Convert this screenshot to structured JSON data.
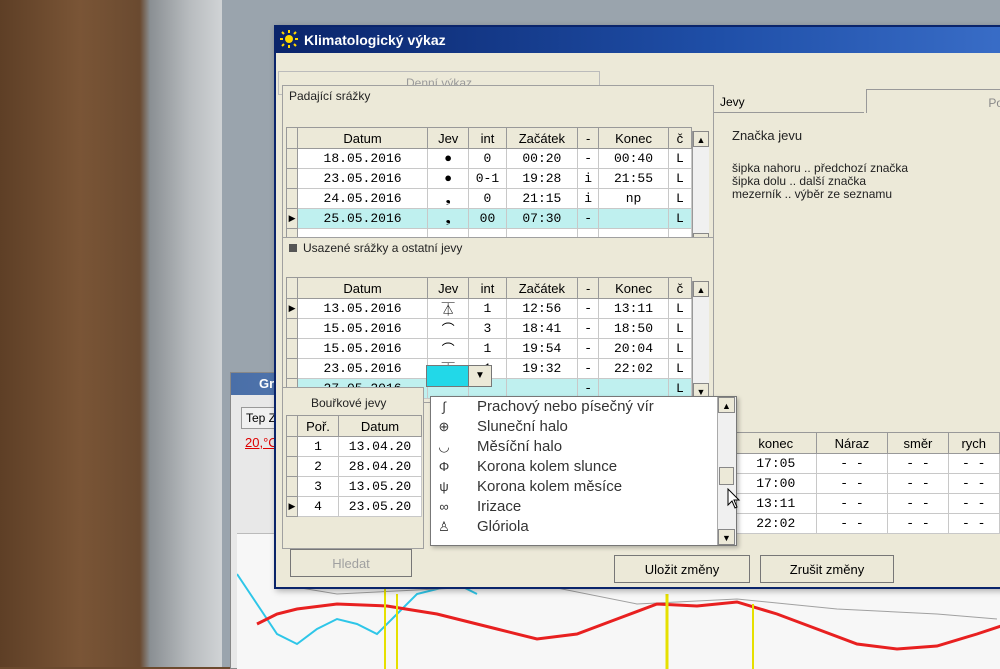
{
  "window": {
    "title": "Klimatologický výkaz",
    "daily_tab": "Denní výkaz"
  },
  "falling": {
    "caption": "Padající srážky",
    "columns": [
      "Datum",
      "Jev",
      "int",
      "Začátek",
      "-",
      "Konec",
      "č"
    ],
    "rows": [
      {
        "date": "18.05.2016",
        "jev": "●",
        "int": "0",
        "start": "00:20",
        "dash": "-",
        "end": "00:40",
        "c": "L"
      },
      {
        "date": "23.05.2016",
        "jev": "●",
        "int": "0-1",
        "start": "19:28",
        "dash": "i",
        "end": "21:55",
        "c": "L"
      },
      {
        "date": "24.05.2016",
        "jev": "❟",
        "int": "0",
        "start": "21:15",
        "dash": "i",
        "end": "np",
        "c": "L"
      },
      {
        "date": "25.05.2016",
        "jev": "❟",
        "int": "00",
        "start": "07:30",
        "dash": "-",
        "end": "",
        "c": "L"
      }
    ]
  },
  "settled": {
    "caption": "Usazené srážky a ostatní jevy",
    "columns": [
      "Datum",
      "Jev",
      "int",
      "Začátek",
      "-",
      "Konec",
      "č"
    ],
    "rows": [
      {
        "date": "13.05.2016",
        "jev": "⏄",
        "int": "1",
        "start": "12:56",
        "dash": "-",
        "end": "13:11",
        "c": "L"
      },
      {
        "date": "15.05.2016",
        "jev": "⌒",
        "int": "3",
        "start": "18:41",
        "dash": "-",
        "end": "18:50",
        "c": "L"
      },
      {
        "date": "15.05.2016",
        "jev": "⌒",
        "int": "1",
        "start": "19:54",
        "dash": "-",
        "end": "20:04",
        "c": "L"
      },
      {
        "date": "23.05.2016",
        "jev": "⏄",
        "int": "1",
        "start": "19:32",
        "dash": "-",
        "end": "22:02",
        "c": "L"
      },
      {
        "date": "27.05.2016",
        "jev": "",
        "int": "",
        "start": "",
        "dash": "-",
        "end": "",
        "c": "L"
      }
    ]
  },
  "storm": {
    "tab": "Bouřkové jevy",
    "columns": [
      "Poř.",
      "Datum"
    ],
    "rows": [
      {
        "n": "1",
        "date": "13.04.20"
      },
      {
        "n": "2",
        "date": "28.04.20"
      },
      {
        "n": "3",
        "date": "13.05.20"
      },
      {
        "n": "4",
        "date": "23.05.20"
      }
    ]
  },
  "storm_right": {
    "columns": [
      "konec",
      "Náraz",
      "směr",
      "rych"
    ],
    "rows": [
      {
        "end": "17:05",
        "a": "- -",
        "b": "- -",
        "c": "- -"
      },
      {
        "end": "17:00",
        "a": "- -",
        "b": "- -",
        "c": "- -"
      },
      {
        "end": "13:11",
        "a": "- -",
        "b": "- -",
        "c": "- -"
      },
      {
        "end": "22:02",
        "a": "- -",
        "b": "- -",
        "c": "- -"
      }
    ]
  },
  "dropdown": {
    "items": [
      {
        "icon": "∫",
        "label": "Prachový nebo písečný vír"
      },
      {
        "icon": "⊕",
        "label": "Sluneční halo"
      },
      {
        "icon": "◡",
        "label": "Měsíční halo"
      },
      {
        "icon": "Φ",
        "label": "Korona kolem slunce"
      },
      {
        "icon": "ψ",
        "label": "Korona kolem měsíce"
      },
      {
        "icon": "∞",
        "label": "Irizace"
      },
      {
        "icon": "♙",
        "label": "Glóriola"
      }
    ]
  },
  "right_panel": {
    "tab1": "Jevy",
    "tab2": "Poz",
    "title": "Značka jevu",
    "lines": [
      "šipka nahoru .. předchozí značka",
      "šipka dolu .. další značka",
      "mezerník .. výběr ze seznamu"
    ]
  },
  "buttons": {
    "search": "Hledat",
    "save": "Uložit změny",
    "cancel": "Zrušit změny"
  },
  "bg": {
    "title": "Gr",
    "tab": "Tep Z",
    "temp": "20,°C"
  }
}
